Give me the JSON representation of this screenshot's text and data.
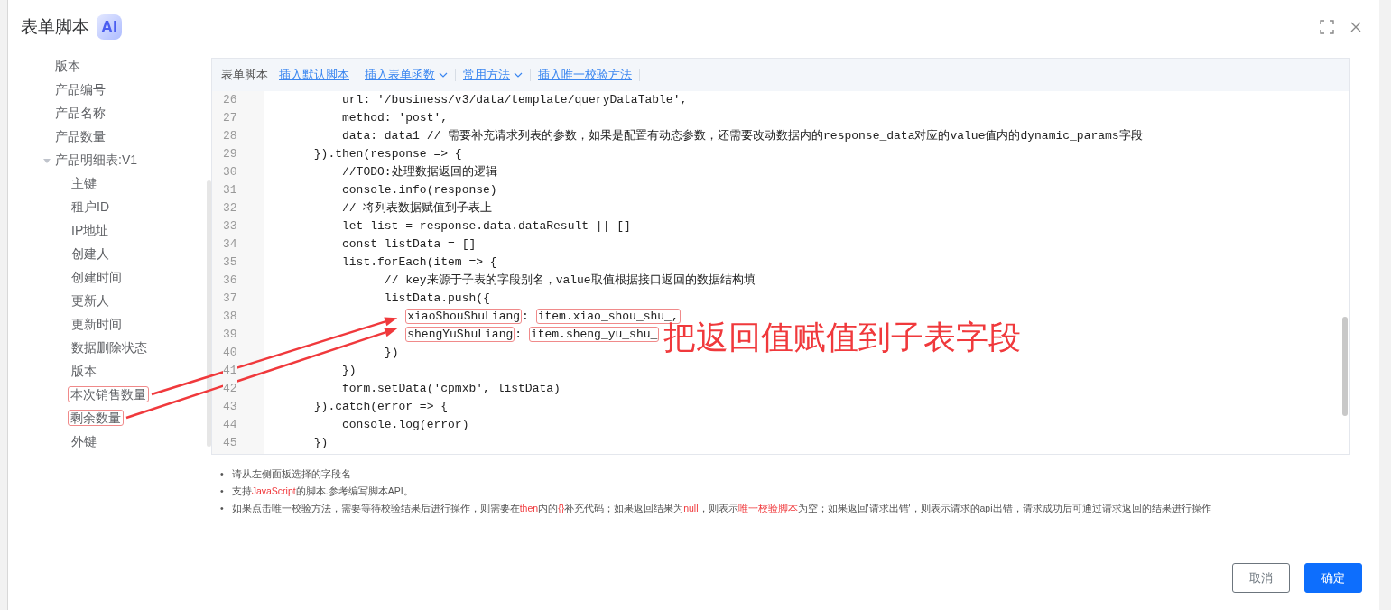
{
  "dialog": {
    "title": "表单脚本",
    "badge": "Ai"
  },
  "tree": [
    {
      "label": "版本",
      "highlighted": false
    },
    {
      "label": "产品编号",
      "highlighted": false
    },
    {
      "label": "产品名称",
      "highlighted": false
    },
    {
      "label": "产品数量",
      "highlighted": false
    },
    {
      "label": "产品明细表:V1",
      "highlighted": false,
      "expanded": true,
      "children": [
        {
          "label": "主键",
          "highlighted": false
        },
        {
          "label": "租户ID",
          "highlighted": false
        },
        {
          "label": "IP地址",
          "highlighted": false
        },
        {
          "label": "创建人",
          "highlighted": false
        },
        {
          "label": "创建时间",
          "highlighted": false
        },
        {
          "label": "更新人",
          "highlighted": false
        },
        {
          "label": "更新时间",
          "highlighted": false
        },
        {
          "label": "数据删除状态",
          "highlighted": false
        },
        {
          "label": "版本",
          "highlighted": false
        },
        {
          "label": "本次销售数量",
          "highlighted": true
        },
        {
          "label": "剩余数量",
          "highlighted": true
        },
        {
          "label": "外键",
          "highlighted": false
        }
      ]
    }
  ],
  "toolbar": [
    {
      "kind": "title",
      "label": "表单脚本"
    },
    {
      "kind": "action",
      "label": "插入默认脚本"
    },
    {
      "kind": "dropdown",
      "label": "插入表单函数"
    },
    {
      "kind": "dropdown",
      "label": "常用方法"
    },
    {
      "kind": "action",
      "label": "插入唯一校验方法"
    }
  ],
  "code_lines": [
    {
      "no": "26",
      "segments": [
        {
          "text": "          url: '/business/v3/data/template/queryDataTable',",
          "highlighted": false
        }
      ]
    },
    {
      "no": "27",
      "segments": [
        {
          "text": "          method: 'post',",
          "highlighted": false
        }
      ]
    },
    {
      "no": "28",
      "segments": [
        {
          "text": "          data: data1 // 需要补充请求列表的参数，如果是配置有动态参数，还需要改动数据内的response_data对应的value值内的dynamic_params字段",
          "highlighted": false
        }
      ]
    },
    {
      "no": "29",
      "segments": [
        {
          "text": "      }).then(response => {",
          "highlighted": false
        }
      ]
    },
    {
      "no": "30",
      "segments": [
        {
          "text": "          //TODO:处理数据返回的逻辑",
          "highlighted": false
        }
      ]
    },
    {
      "no": "31",
      "segments": [
        {
          "text": "          console.info(response)",
          "highlighted": false
        }
      ]
    },
    {
      "no": "32",
      "segments": [
        {
          "text": "          // 将列表数据赋值到子表上",
          "highlighted": false
        }
      ]
    },
    {
      "no": "33",
      "segments": [
        {
          "text": "          let list = response.data.dataResult || []",
          "highlighted": false
        }
      ]
    },
    {
      "no": "34",
      "segments": [
        {
          "text": "          const listData = []",
          "highlighted": false
        }
      ]
    },
    {
      "no": "35",
      "segments": [
        {
          "text": "          list.forEach(item => {",
          "highlighted": false
        }
      ]
    },
    {
      "no": "36",
      "segments": [
        {
          "text": "                // key来源于子表的字段别名，value取值根据接口返回的数据结构填",
          "highlighted": false
        }
      ]
    },
    {
      "no": "37",
      "segments": [
        {
          "text": "                listData.push({",
          "highlighted": false
        }
      ]
    },
    {
      "no": "38",
      "segments": [
        {
          "text": "                   xiaoShouShuLiang",
          "highlighted": true
        },
        {
          "text": ": ",
          "highlighted": false
        },
        {
          "text": "item.xiao_shou_shu_,",
          "highlighted": true
        }
      ]
    },
    {
      "no": "39",
      "segments": [
        {
          "text": "                   shengYuShuLiang",
          "highlighted": true
        },
        {
          "text": ": ",
          "highlighted": false
        },
        {
          "text": "item.sheng_yu_shu_",
          "highlighted": true
        }
      ]
    },
    {
      "no": "40",
      "segments": [
        {
          "text": "                })",
          "highlighted": false
        }
      ]
    },
    {
      "no": "41",
      "segments": [
        {
          "text": "          })",
          "highlighted": false
        }
      ]
    },
    {
      "no": "42",
      "segments": [
        {
          "text": "          form.setData('cpmxb', listData)",
          "highlighted": false
        }
      ]
    },
    {
      "no": "43",
      "segments": [
        {
          "text": "      }).catch(error => {",
          "highlighted": false
        }
      ]
    },
    {
      "no": "44",
      "segments": [
        {
          "text": "          console.log(error)",
          "highlighted": false
        }
      ]
    },
    {
      "no": "45",
      "segments": [
        {
          "text": "      })",
          "highlighted": false
        }
      ]
    }
  ],
  "annotation": {
    "text": "把返回值赋值到子表字段"
  },
  "notes": [
    {
      "bullet": "•",
      "parts": [
        {
          "text": "请从左侧面板选择的字段名",
          "red": false
        }
      ]
    },
    {
      "bullet": "•",
      "parts": [
        {
          "text": "支持",
          "red": false
        },
        {
          "text": "JavaScript",
          "red": true
        },
        {
          "text": "的脚本.参考编写脚本API。",
          "red": false
        }
      ]
    },
    {
      "bullet": "•",
      "parts": [
        {
          "text": "如果点击唯一校验方法，需要等待校验结果后进行操作，则需要在",
          "red": false
        },
        {
          "text": "then",
          "red": true
        },
        {
          "text": "内的",
          "red": false
        },
        {
          "text": "{}",
          "red": true
        },
        {
          "text": "补充代码；如果返回结果为",
          "red": false
        },
        {
          "text": "null",
          "red": true
        },
        {
          "text": "，则表示",
          "red": false
        },
        {
          "text": "唯一校验脚本",
          "red": true
        },
        {
          "text": "为空；如果返回'请求出错'，则表示请求的api出错，请求成功后可通过请求返回的结果进行操作",
          "red": false
        }
      ]
    }
  ],
  "buttons": [
    {
      "label": "取消",
      "kind": "secondary"
    },
    {
      "label": "确定",
      "kind": "primary"
    }
  ]
}
